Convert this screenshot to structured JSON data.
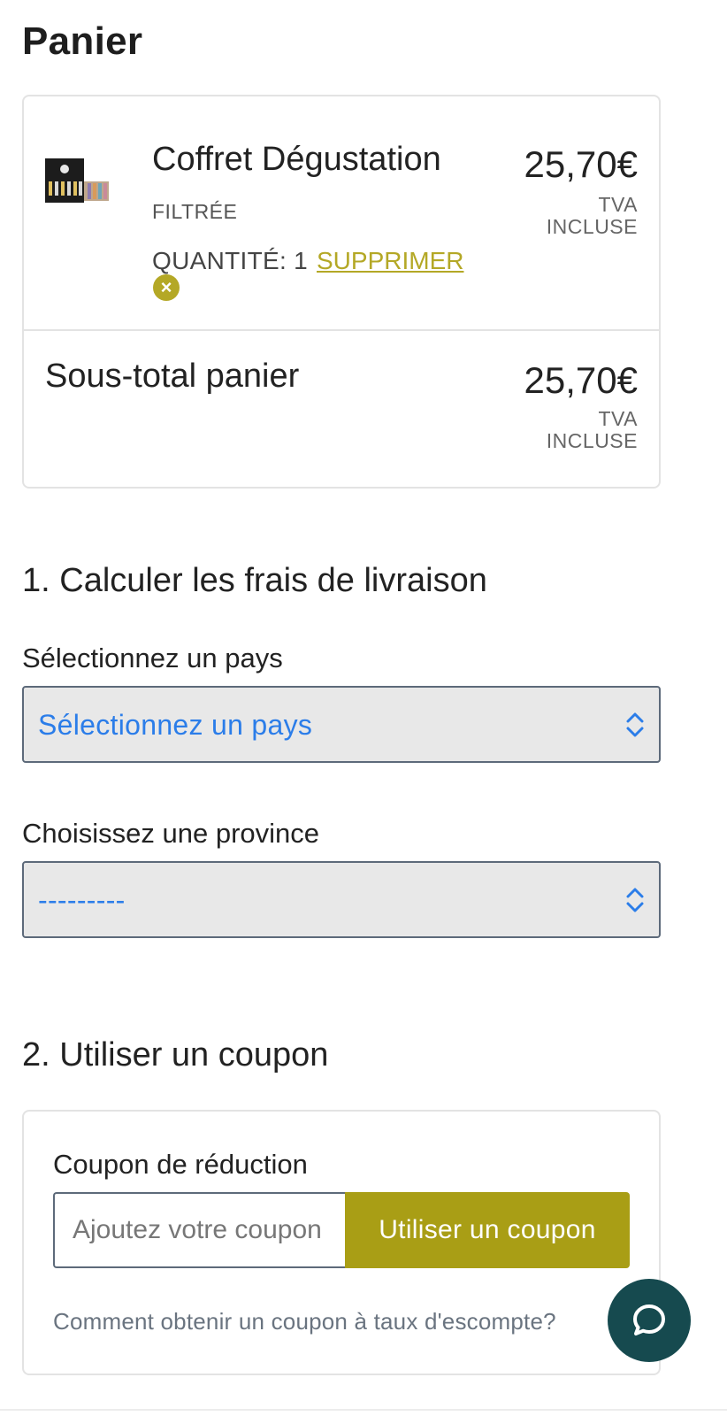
{
  "page": {
    "title": "Panier"
  },
  "cart": {
    "item": {
      "name": "Coffret Dégustation",
      "variant": "FILTRÉE",
      "quantity_label": "QUANTITÉ: 1",
      "remove_label": "SUPPRIMER",
      "price": "25,70€",
      "tax_note": "TVA INCLUSE",
      "image_icon": "product-thumbnail"
    },
    "subtotal": {
      "label": "Sous-total panier",
      "price": "25,70€",
      "tax_note": "TVA INCLUSE"
    }
  },
  "shipping": {
    "title": "1. Calculer les frais de livraison",
    "country": {
      "label": "Sélectionnez un pays",
      "value": "Sélectionnez un pays"
    },
    "province": {
      "label": "Choisissez une province",
      "value": "---------"
    }
  },
  "coupon": {
    "title": "2. Utiliser un coupon",
    "label": "Coupon de réduction",
    "placeholder": "Ajoutez votre coupon",
    "button": "Utiliser un coupon",
    "help": "Comment obtenir un coupon à taux d'escompte?"
  },
  "chat": {
    "icon": "chat-bubble-icon"
  },
  "colors": {
    "accent": "#a99e15",
    "link": "#b4a826",
    "select_text": "#2b7de9",
    "chat": "#164a4f"
  }
}
